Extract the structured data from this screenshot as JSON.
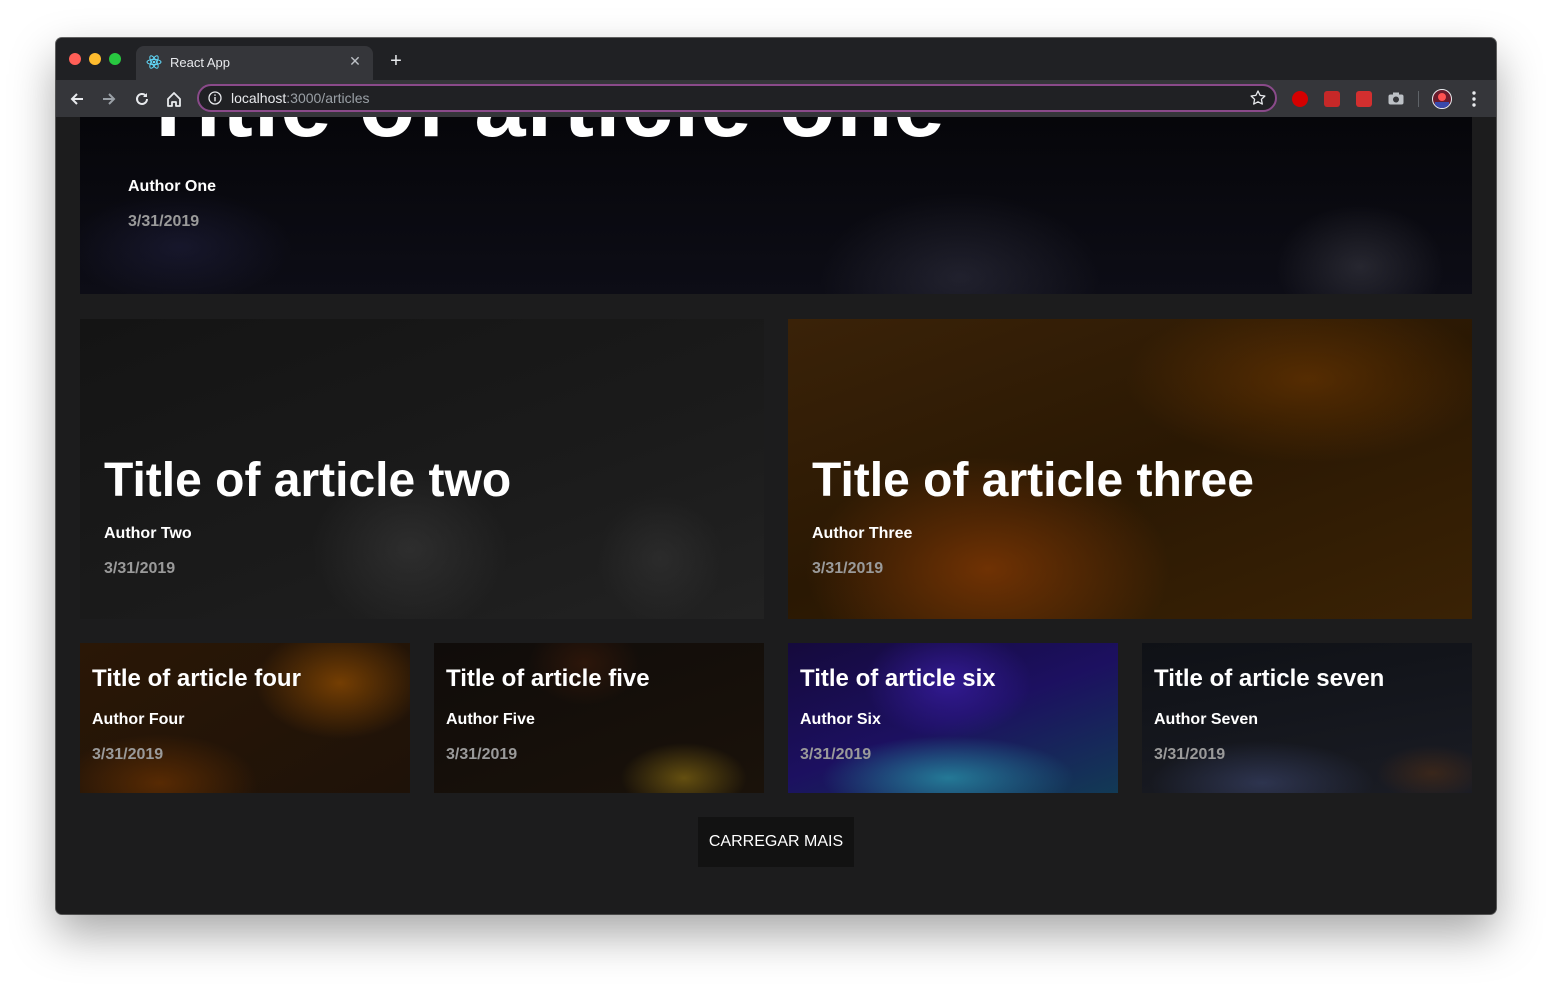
{
  "browser": {
    "tab_title": "React App",
    "url_host": "localhost",
    "url_path": ":3000/articles",
    "icons": [
      "react-icon",
      "close-icon",
      "plus-icon",
      "back-icon",
      "forward-icon",
      "reload-icon",
      "home-icon",
      "info-icon",
      "star-icon",
      "menu-icon"
    ]
  },
  "articles": {
    "featured": {
      "title": "Title of article one",
      "author": "Author One",
      "date": "3/31/2019"
    },
    "medium": [
      {
        "title": "Title of article two",
        "author": "Author Two",
        "date": "3/31/2019"
      },
      {
        "title": "Title of article three",
        "author": "Author Three",
        "date": "3/31/2019"
      }
    ],
    "small": [
      {
        "title": "Title of article four",
        "author": "Author Four",
        "date": "3/31/2019"
      },
      {
        "title": "Title of article five",
        "author": "Author Five",
        "date": "3/31/2019"
      },
      {
        "title": "Title of article six",
        "author": "Author Six",
        "date": "3/31/2019"
      },
      {
        "title": "Title of article seven",
        "author": "Author Seven",
        "date": "3/31/2019"
      }
    ]
  },
  "load_more_label": "CARREGAR MAIS",
  "colors": {
    "page_background": "#1c1c1d",
    "button_background": "#121212",
    "date_text": "#9a9a9a",
    "omnibox_border": "#8a4a8a"
  }
}
